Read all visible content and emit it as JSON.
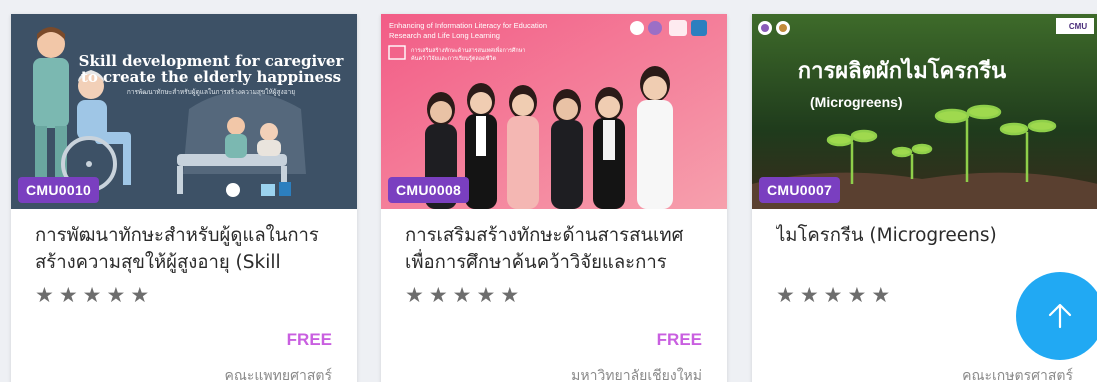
{
  "courses": [
    {
      "code": "CMU0010",
      "title": "การพัฒนาทักษะสำหรับผู้ดูแลในการสร้างความสุขให้ผู้สูงอายุ (Skill",
      "price": "FREE",
      "faculty": "คณะแพทยศาสตร์",
      "rating_text": "★★★★★",
      "banner": {
        "headline": "Skill development for caregiver to create the elderly happiness",
        "subline": "การพัฒนาทักษะสำหรับผู้ดูแลในการสร้างความสุขให้ผู้สูงอายุ"
      },
      "colors": {
        "bg": "#3d5166"
      }
    },
    {
      "code": "CMU0008",
      "title": "การเสริมสร้างทักษะด้านสารสนเทศเพื่อการศึกษาค้นคว้าวิจัยและการ",
      "price": "FREE",
      "faculty": "มหาวิทยาลัยเชียงใหม่",
      "rating_text": "★★★★★",
      "banner": {
        "headline": "Enhancing of Information Literacy for Education Research and Life Long Learning",
        "subline": "การเสริมสร้างทักษะด้านสารสนเทศเพื่อการศึกษาค้นคว้าวิจัยและการเรียนรู้ตลอดชีวิต"
      },
      "colors": {
        "bg": "#f07a93"
      }
    },
    {
      "code": "CMU0007",
      "title": "ไมโครกรีน (Microgreens)",
      "price": "",
      "faculty": "คณะเกษตรศาสตร์",
      "rating_text": "★★★★★",
      "banner": {
        "headline": "การผลิตผักไมโครกรีน",
        "subline": "(Microgreens)",
        "logo_text": "CMU"
      },
      "colors": {
        "bg": "#1f3b1c"
      }
    }
  ],
  "scroll_top": {
    "icon": "arrow-up-icon"
  },
  "theme": {
    "badge": "#7a3fc0",
    "price": "#c95fe0",
    "fab": "#21a9f3",
    "star": "#6d6d6d"
  }
}
